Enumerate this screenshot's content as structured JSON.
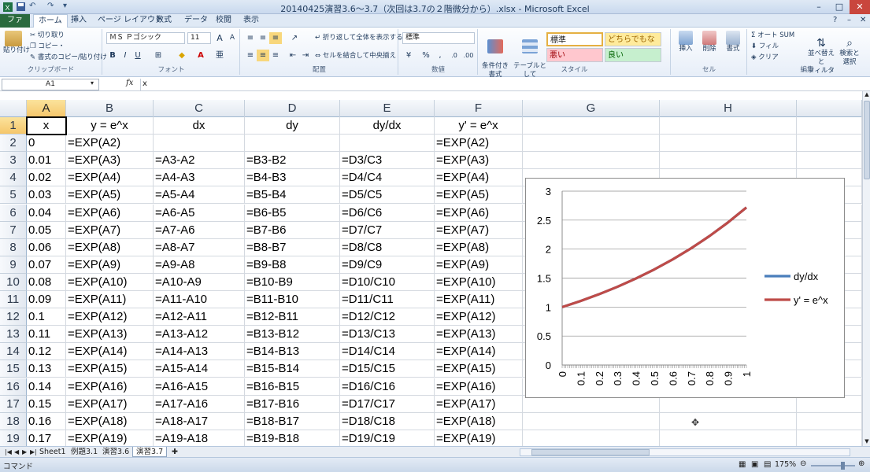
{
  "window": {
    "title": "20140425演習3.6～3.7（次回は3.7の２階微分から）.xlsx - Microsoft Excel"
  },
  "ribbon_tabs": [
    "ファイル",
    "ホーム",
    "挿入",
    "ページ レイアウト",
    "数式",
    "データ",
    "校閲",
    "表示"
  ],
  "clipboard": {
    "paste": "貼り付け",
    "cut": "切り取り",
    "copy": "コピー・",
    "format_painter": "書式のコピー/貼り付け",
    "label": "クリップボード"
  },
  "font": {
    "name": "ＭＳ Ｐゴシック",
    "size": "11",
    "bold": "B",
    "italic": "I",
    "underline": "U",
    "grow": "A",
    "shrink": "A",
    "label": "フォント"
  },
  "alignment": {
    "wrap": "折り返して全体を表示する",
    "merge": "セルを結合して中央揃え",
    "label": "配置"
  },
  "number": {
    "format": "標準",
    "percent": "%",
    "comma": ",",
    "label": "数値"
  },
  "styles": {
    "cond_format": "条件付き\n書式",
    "table_format": "テーブルとして\n書式設定",
    "normal": "標準",
    "neutral": "どちらでもない",
    "bad": "悪い",
    "good": "良い",
    "label": "スタイル"
  },
  "cells": {
    "insert": "挿入",
    "delete": "削除",
    "format": "書式",
    "label": "セル"
  },
  "editing": {
    "autosum": "オート SUM",
    "fill": "フィル",
    "clear": "クリア",
    "sort": "並べ替えと\nフィルター",
    "find": "検索と\n選択",
    "label": "編集"
  },
  "formula_bar": {
    "name_box": "A1",
    "fx": "fx",
    "value": "x"
  },
  "columns": [
    "A",
    "B",
    "C",
    "D",
    "E",
    "F",
    "G",
    "H"
  ],
  "header_row": [
    "x",
    "y = e^x",
    "dx",
    "dy",
    "dy/dx",
    "y' = e^x"
  ],
  "rows": [
    [
      "1",
      "x",
      "y = e^x",
      "dx",
      "dy",
      "dy/dx",
      "y' = e^x"
    ],
    [
      "2",
      "0",
      "=EXP(A2)",
      "",
      "",
      "",
      "=EXP(A2)"
    ],
    [
      "3",
      "0.01",
      "=EXP(A3)",
      "=A3-A2",
      "=B3-B2",
      "=D3/C3",
      "=EXP(A3)"
    ],
    [
      "4",
      "0.02",
      "=EXP(A4)",
      "=A4-A3",
      "=B4-B3",
      "=D4/C4",
      "=EXP(A4)"
    ],
    [
      "5",
      "0.03",
      "=EXP(A5)",
      "=A5-A4",
      "=B5-B4",
      "=D5/C5",
      "=EXP(A5)"
    ],
    [
      "6",
      "0.04",
      "=EXP(A6)",
      "=A6-A5",
      "=B6-B5",
      "=D6/C6",
      "=EXP(A6)"
    ],
    [
      "7",
      "0.05",
      "=EXP(A7)",
      "=A7-A6",
      "=B7-B6",
      "=D7/C7",
      "=EXP(A7)"
    ],
    [
      "8",
      "0.06",
      "=EXP(A8)",
      "=A8-A7",
      "=B8-B7",
      "=D8/C8",
      "=EXP(A8)"
    ],
    [
      "9",
      "0.07",
      "=EXP(A9)",
      "=A9-A8",
      "=B9-B8",
      "=D9/C9",
      "=EXP(A9)"
    ],
    [
      "10",
      "0.08",
      "=EXP(A10)",
      "=A10-A9",
      "=B10-B9",
      "=D10/C10",
      "=EXP(A10)"
    ],
    [
      "11",
      "0.09",
      "=EXP(A11)",
      "=A11-A10",
      "=B11-B10",
      "=D11/C11",
      "=EXP(A11)"
    ],
    [
      "12",
      "0.1",
      "=EXP(A12)",
      "=A12-A11",
      "=B12-B11",
      "=D12/C12",
      "=EXP(A12)"
    ],
    [
      "13",
      "0.11",
      "=EXP(A13)",
      "=A13-A12",
      "=B13-B12",
      "=D13/C13",
      "=EXP(A13)"
    ],
    [
      "14",
      "0.12",
      "=EXP(A14)",
      "=A14-A13",
      "=B14-B13",
      "=D14/C14",
      "=EXP(A14)"
    ],
    [
      "15",
      "0.13",
      "=EXP(A15)",
      "=A15-A14",
      "=B15-B14",
      "=D15/C15",
      "=EXP(A15)"
    ],
    [
      "16",
      "0.14",
      "=EXP(A16)",
      "=A16-A15",
      "=B16-B15",
      "=D16/C16",
      "=EXP(A16)"
    ],
    [
      "17",
      "0.15",
      "=EXP(A17)",
      "=A17-A16",
      "=B17-B16",
      "=D17/C17",
      "=EXP(A17)"
    ],
    [
      "18",
      "0.16",
      "=EXP(A18)",
      "=A18-A17",
      "=B18-B17",
      "=D18/C18",
      "=EXP(A18)"
    ],
    [
      "19",
      "0.17",
      "=EXP(A19)",
      "=A19-A18",
      "=B19-B18",
      "=D19/C19",
      "=EXP(A19)"
    ]
  ],
  "chart_data": {
    "type": "line",
    "x": [
      0,
      0.1,
      0.2,
      0.3,
      0.4,
      0.5,
      0.6,
      0.7,
      0.8,
      0.9,
      1
    ],
    "x_tick_labels": [
      "0",
      "0.1",
      "0.2",
      "0.3",
      "0.4",
      "0.5",
      "0.6",
      "0.7",
      "0.8",
      "0.9",
      "1"
    ],
    "y_tick_labels": [
      "0",
      "0.5",
      "1",
      "1.5",
      "2",
      "2.5",
      "3"
    ],
    "ylim": [
      0,
      3
    ],
    "series": [
      {
        "name": "dy/dx",
        "color": "#4a7ebb",
        "values": [
          1,
          1.105,
          1.221,
          1.35,
          1.492,
          1.649,
          1.822,
          2.014,
          2.226,
          2.46,
          2.718
        ]
      },
      {
        "name": "y' = e^x",
        "color": "#be4b48",
        "values": [
          1,
          1.105,
          1.221,
          1.35,
          1.492,
          1.649,
          1.822,
          2.014,
          2.226,
          2.46,
          2.718
        ]
      }
    ],
    "legend": "right",
    "grid": true
  },
  "sheet_tabs": [
    "Sheet1",
    "例題3.1",
    "演習3.6",
    "演習3.7"
  ],
  "status": {
    "mode": "コマンド",
    "zoom": "175%"
  },
  "colors": {
    "file_tab": "#2a6a3e",
    "selection": "#f5c66a"
  }
}
